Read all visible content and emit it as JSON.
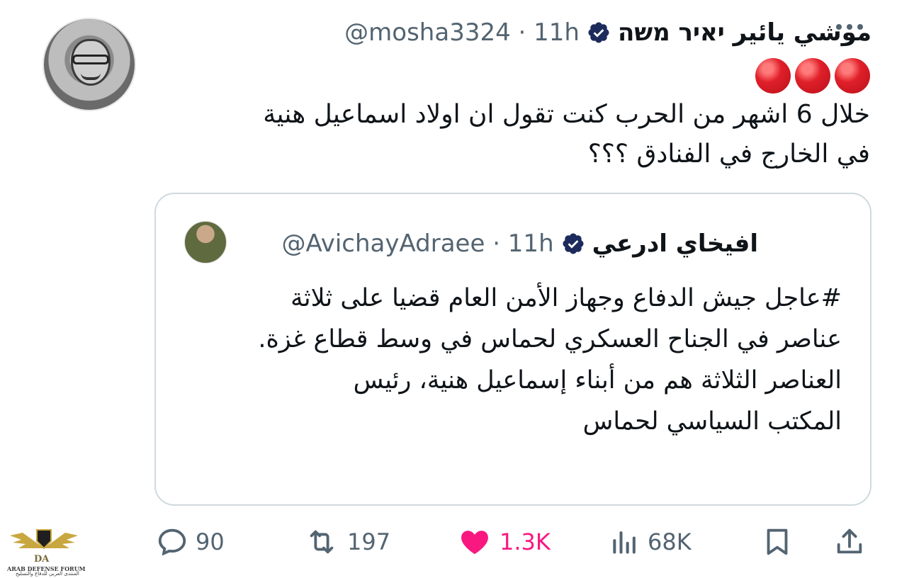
{
  "tweet": {
    "author_name": "موشي يائير יאיר משה",
    "handle": "@mosha3324",
    "time": "· 11h",
    "emoji_count": 3,
    "text_line1": "خلال 6 اشهر من الحرب كنت تقول ان اولاد اسماعيل هنية",
    "text_line2": "في الخارج في الفنادق ؟؟؟"
  },
  "quoted": {
    "author_name": "افيخاي ادرعي",
    "handle": "@AvichayAdraee",
    "time": "· 11h",
    "lines": [
      "#عاجل جيش الدفاع وجهاز الأمن العام قضيا على ثلاثة",
      "عناصر في الجناح العسكري لحماس في وسط قطاع غزة.",
      "العناصر الثلاثة هم من أبناء إسماعيل هنية، رئيس",
      "المكتب السياسي لحماس"
    ]
  },
  "actions": {
    "replies": "90",
    "reposts": "197",
    "likes": "1.3K",
    "views": "68K"
  },
  "watermark": {
    "logo": "DA",
    "title": "ARAB DEFENSE FORUM",
    "subtitle": "المنتدى العربي للدفاع والتسليح"
  },
  "colors": {
    "verified": "#1d2a5c",
    "like": "#f91880",
    "secondary_text": "#536471"
  }
}
